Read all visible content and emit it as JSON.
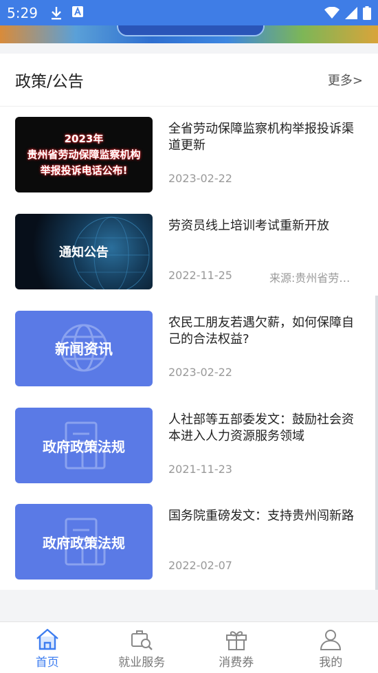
{
  "status_bar": {
    "time": "5:29",
    "icons": [
      "download-icon",
      "app-notification-icon",
      "wifi-icon",
      "signal-icon",
      "battery-icon"
    ]
  },
  "section": {
    "title": "政策/公告",
    "more": "更多>"
  },
  "news": [
    {
      "thumb_text": "2023年\n贵州省劳动保障监察机构\n举报投诉电话公布!",
      "thumb_style": "dark-red",
      "title": "全省劳动保障监察机构举报投诉渠道更新",
      "date": "2023-02-22",
      "source": ""
    },
    {
      "thumb_text": "通知公告",
      "thumb_style": "globe",
      "title": "劳资员线上培训考试重新开放",
      "date": "2022-11-25",
      "source": "来源:贵州省劳动保障"
    },
    {
      "thumb_text": "新闻资讯",
      "thumb_style": "blue-globe",
      "title": "农民工朋友若遇欠薪，如何保障自己的合法权益?",
      "date": "2023-02-22",
      "source": ""
    },
    {
      "thumb_text": "政府政策法规",
      "thumb_style": "blue-doc",
      "title": "人社部等五部委发文：鼓励社会资本进入人力资源服务领域",
      "date": "2021-11-23",
      "source": ""
    },
    {
      "thumb_text": "政府政策法规",
      "thumb_style": "blue-doc",
      "title": "国务院重磅发文：支持贵州闯新路",
      "date": "2022-02-07",
      "source": ""
    }
  ],
  "bottom_nav": [
    {
      "label": "首页",
      "icon": "home-icon",
      "active": true
    },
    {
      "label": "就业服务",
      "icon": "job-search-icon",
      "active": false
    },
    {
      "label": "消费券",
      "icon": "gift-icon",
      "active": false
    },
    {
      "label": "我的",
      "icon": "user-icon",
      "active": false
    }
  ],
  "colors": {
    "status_bar": "#3f7de6",
    "thumb_blue": "#5a7ae6",
    "active_nav": "#3d7df0"
  }
}
